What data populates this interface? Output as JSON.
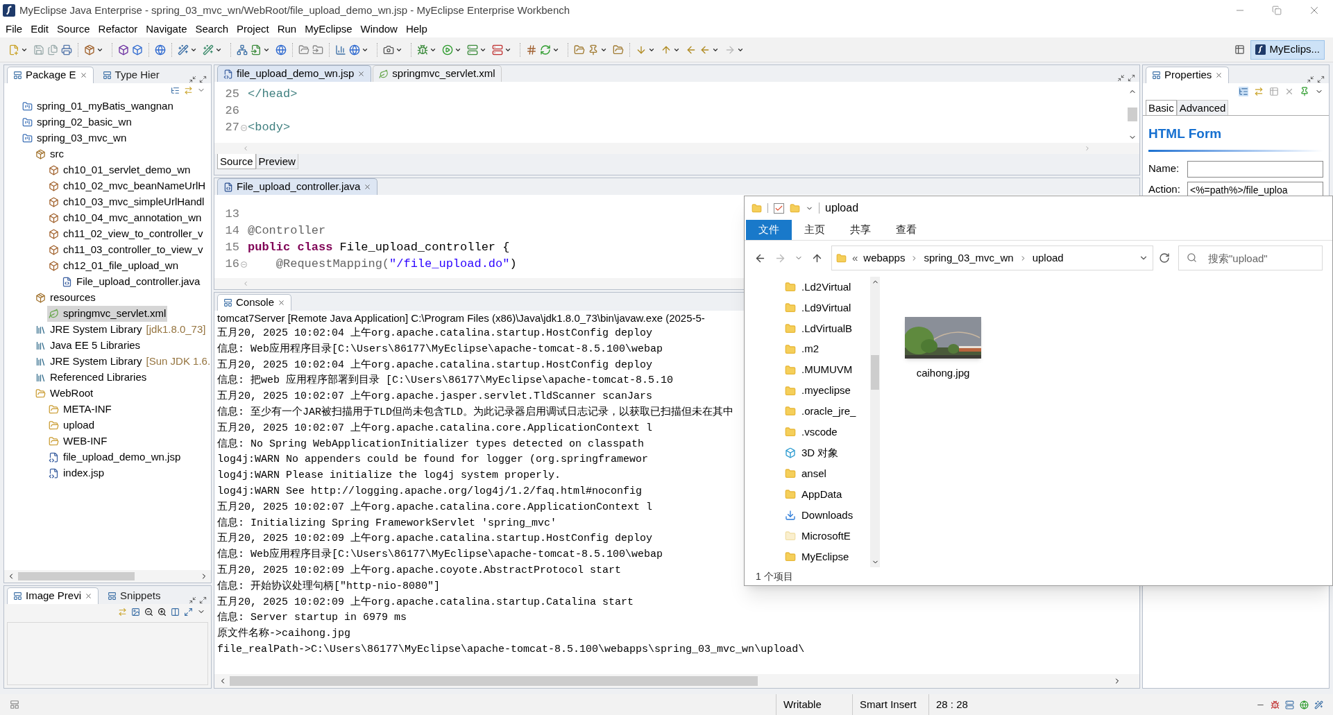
{
  "window": {
    "title": "MyEclipse Java Enterprise - spring_03_mvc_wn/WebRoot/file_upload_demo_wn.jsp - MyEclipse Enterprise Workbench"
  },
  "menu": [
    "File",
    "Edit",
    "Source",
    "Refactor",
    "Navigate",
    "Search",
    "Project",
    "Run",
    "MyEclipse",
    "Window",
    "Help"
  ],
  "perspective": {
    "label": "MyEclips..."
  },
  "package_explorer": {
    "tabs": [
      {
        "label": "Package E",
        "selected": true
      },
      {
        "label": "Type Hier",
        "selected": false
      }
    ],
    "tree": [
      {
        "label": "spring_01_myBatis_wangnan",
        "kind": "project",
        "selected": false
      },
      {
        "label": "spring_02_basic_wn",
        "kind": "project",
        "selected": false
      },
      {
        "label": "spring_03_mvc_wn",
        "kind": "project",
        "selected": false,
        "children": [
          {
            "label": "src",
            "kind": "source-folder",
            "selected": false,
            "children": [
              {
                "label": "ch10_01_servlet_demo_wn",
                "kind": "package",
                "selected": false
              },
              {
                "label": "ch10_02_mvc_beanNameUrlH",
                "kind": "package",
                "selected": false
              },
              {
                "label": "ch10_03_mvc_simpleUrlHandl",
                "kind": "package",
                "selected": false
              },
              {
                "label": "ch10_04_mvc_annotation_wn",
                "kind": "package",
                "selected": false
              },
              {
                "label": "ch11_02_view_to_controller_v",
                "kind": "package",
                "selected": false
              },
              {
                "label": "ch11_03_controller_to_view_v",
                "kind": "package",
                "selected": false
              },
              {
                "label": "ch12_01_file_upload_wn",
                "kind": "package",
                "selected": false,
                "children": [
                  {
                    "label": "File_upload_controller.java",
                    "kind": "java-file",
                    "selected": false
                  }
                ]
              }
            ]
          },
          {
            "label": "resources",
            "kind": "source-folder",
            "selected": false,
            "children": [
              {
                "label": "springmvc_servlet.xml",
                "kind": "xml-file",
                "selected": true
              }
            ]
          },
          {
            "label": "JRE System Library",
            "decoration": "[jdk1.8.0_73]",
            "kind": "library",
            "selected": false
          },
          {
            "label": "Java EE 5 Libraries",
            "kind": "library",
            "selected": false
          },
          {
            "label": "JRE System Library",
            "decoration": "[Sun JDK 1.6.",
            "kind": "library",
            "selected": false
          },
          {
            "label": "Referenced Libraries",
            "kind": "library",
            "selected": false
          },
          {
            "label": "WebRoot",
            "kind": "folder",
            "selected": false,
            "children": [
              {
                "label": "META-INF",
                "kind": "folder",
                "selected": false
              },
              {
                "label": "upload",
                "kind": "folder",
                "selected": false
              },
              {
                "label": "WEB-INF",
                "kind": "folder",
                "selected": false
              },
              {
                "label": "file_upload_demo_wn.jsp",
                "kind": "jsp-file",
                "selected": false
              },
              {
                "label": "index.jsp",
                "kind": "jsp-file",
                "selected": false
              }
            ]
          }
        ]
      }
    ]
  },
  "image_preview": {
    "tabs": [
      {
        "label": "Image Previ",
        "selected": true
      },
      {
        "label": "Snippets",
        "selected": false
      }
    ]
  },
  "jsp_editor": {
    "tabs": [
      {
        "label": "file_upload_demo_wn.jsp",
        "kind": "jsp",
        "selected": true
      },
      {
        "label": "springmvc_servlet.xml",
        "kind": "xml",
        "selected": false
      }
    ],
    "lines": [
      {
        "number": "25",
        "foldable": false,
        "tokens": [
          {
            "text": "</head>",
            "kind": "tag"
          }
        ]
      },
      {
        "number": "26",
        "foldable": false
      },
      {
        "number": "27",
        "foldable": true,
        "tokens": [
          {
            "text": "<body>",
            "kind": "tag"
          }
        ]
      }
    ],
    "mode_tabs": [
      {
        "label": "Source",
        "selected": true
      },
      {
        "label": "Preview",
        "selected": false
      }
    ]
  },
  "java_editor": {
    "tabs": [
      {
        "label": "File_upload_controller.java",
        "kind": "java",
        "selected": true
      }
    ],
    "lines": [
      {
        "number": "13",
        "foldable": false
      },
      {
        "number": "14",
        "foldable": false,
        "tokens": [
          {
            "text": "@Controller",
            "kind": "annotation"
          }
        ]
      },
      {
        "number": "15",
        "foldable": false,
        "tokens": [
          {
            "text": "public class",
            "kind": "keyword"
          },
          {
            "text": " File_upload_controller {",
            "kind": "plain"
          }
        ]
      },
      {
        "number": "16",
        "foldable": true,
        "tokens": [
          {
            "text": "    @RequestMapping(",
            "kind": "annotation"
          },
          {
            "text": "\"/file_upload.do\"",
            "kind": "string"
          },
          {
            "text": ")",
            "kind": "plain"
          }
        ]
      }
    ]
  },
  "console": {
    "title": "Console",
    "process": "tomcat7Server [Remote Java Application] C:\\Program Files (x86)\\Java\\jdk1.8.0_73\\bin\\javaw.exe (2025-5-",
    "lines": [
      "五月20, 2025 10:02:04 上午org.apache.catalina.startup.HostConfig deploy",
      "信息: Web应用程序目录[C:\\Users\\86177\\MyEclipse\\apache-tomcat-8.5.100\\webap",
      "五月20, 2025 10:02:04 上午org.apache.catalina.startup.HostConfig deploy",
      "信息: 把web 应用程序部署到目录 [C:\\Users\\86177\\MyEclipse\\apache-tomcat-8.5.10",
      "五月20, 2025 10:02:07 上午org.apache.jasper.servlet.TldScanner scanJars",
      "信息: 至少有一个JAR被扫描用于TLD但尚未包含TLD。为此记录器启用调试日志记录，以获取已扫描但未在其中",
      "五月20, 2025 10:02:07 上午org.apache.catalina.core.ApplicationContext l",
      "信息: No Spring WebApplicationInitializer types detected on classpath",
      "log4j:WARN No appenders could be found for logger (org.springframewor",
      "log4j:WARN Please initialize the log4j system properly.",
      "log4j:WARN See http://logging.apache.org/log4j/1.2/faq.html#noconfig",
      "五月20, 2025 10:02:07 上午org.apache.catalina.core.ApplicationContext l",
      "信息: Initializing Spring FrameworkServlet 'spring_mvc'",
      "五月20, 2025 10:02:09 上午org.apache.catalina.startup.HostConfig deploy",
      "信息: Web应用程序目录[C:\\Users\\86177\\MyEclipse\\apache-tomcat-8.5.100\\webap",
      "五月20, 2025 10:02:09 上午org.apache.coyote.AbstractProtocol start",
      "信息: 开始协议处理句柄[\"http-nio-8080\"]",
      "五月20, 2025 10:02:09 上午org.apache.catalina.startup.Catalina start",
      "信息: Server startup in 6979 ms",
      "原文件名称->caihong.jpg",
      "file_realPath->C:\\Users\\86177\\MyEclipse\\apache-tomcat-8.5.100\\webapps\\spring_03_mvc_wn\\upload\\"
    ]
  },
  "properties": {
    "title": "Properties",
    "tabs": [
      {
        "label": "Basic",
        "selected": true
      },
      {
        "label": "Advanced",
        "selected": false
      }
    ],
    "heading": "HTML Form",
    "fields": [
      {
        "label": "Name:"
      },
      {
        "label": "Action:",
        "value": "<%=path%>/file_uploa"
      }
    ]
  },
  "explorer": {
    "title": "upload",
    "ribbon_tabs": [
      {
        "label": "文件",
        "selected": true
      },
      {
        "label": "主页",
        "selected": false
      },
      {
        "label": "共享",
        "selected": false
      },
      {
        "label": "查看",
        "selected": false
      }
    ],
    "overflow_mark": "«",
    "breadcrumb": [
      "webapps",
      "spring_03_mvc_wn",
      "upload"
    ],
    "search": {
      "placeholder": "搜索\"upload\""
    },
    "nav_items": [
      {
        "label": ".Ld2Virtual",
        "kind": "folder"
      },
      {
        "label": ".Ld9Virtual",
        "kind": "folder"
      },
      {
        "label": ".LdVirtualB",
        "kind": "folder"
      },
      {
        "label": ".m2",
        "kind": "folder"
      },
      {
        "label": ".MUMUVM",
        "kind": "folder"
      },
      {
        "label": ".myeclipse",
        "kind": "folder"
      },
      {
        "label": ".oracle_jre_",
        "kind": "folder"
      },
      {
        "label": ".vscode",
        "kind": "folder"
      },
      {
        "label": "3D 对象",
        "kind": "cube"
      },
      {
        "label": "ansel",
        "kind": "folder"
      },
      {
        "label": "AppData",
        "kind": "folder"
      },
      {
        "label": "Downloads",
        "kind": "download"
      },
      {
        "label": "MicrosoftE",
        "kind": "pale-folder"
      },
      {
        "label": "MyEclipse",
        "kind": "folder"
      }
    ],
    "files": [
      {
        "name": "caihong.jpg",
        "kind": "picture"
      }
    ],
    "status": "1 个项目"
  },
  "status_bar": [
    "Writable",
    "Smart Insert",
    "28 : 28"
  ]
}
